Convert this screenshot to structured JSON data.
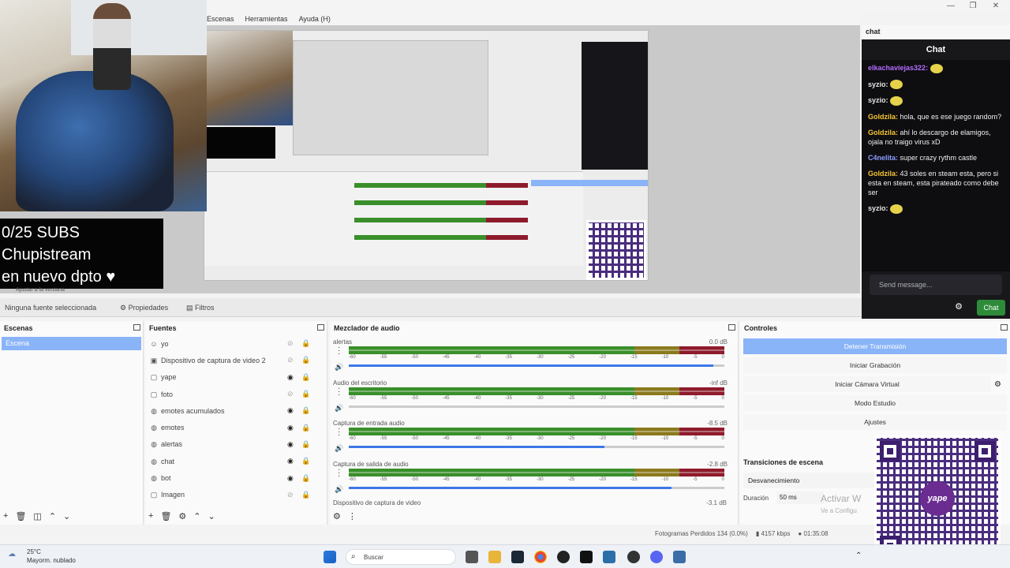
{
  "menu": [
    "Escenas",
    "Herramientas",
    "Ayuda (H)"
  ],
  "window_controls": [
    "—",
    "❐",
    "✕"
  ],
  "overlay": {
    "subs_lines": [
      "0/25 SUBS",
      "Chupistream",
      "en nuevo dpto ♥"
    ]
  },
  "preview_bottom_label": "Ajustar a la ventana",
  "status_bar": {
    "no_source": "Ninguna fuente seleccionada",
    "properties": "Propiedades",
    "filters": "Filtros"
  },
  "scenes": {
    "title": "Escenas",
    "items": [
      "Escena"
    ]
  },
  "sources": {
    "title": "Fuentes",
    "items": [
      {
        "label": "yo",
        "icon": "person-icon",
        "visible": false,
        "locked": false
      },
      {
        "label": "Dispositivo de captura de video 2",
        "icon": "camera-icon",
        "visible": false,
        "locked": false
      },
      {
        "label": "yape",
        "icon": "image-icon",
        "visible": true,
        "locked": false
      },
      {
        "label": "foto",
        "icon": "image-icon",
        "visible": false,
        "locked": false
      },
      {
        "label": "emotes acumulados",
        "icon": "globe-icon",
        "visible": true,
        "locked": false
      },
      {
        "label": "emotes",
        "icon": "globe-icon",
        "visible": true,
        "locked": false
      },
      {
        "label": "alertas",
        "icon": "globe-icon",
        "visible": true,
        "locked": false
      },
      {
        "label": "chat",
        "icon": "globe-icon",
        "visible": true,
        "locked": false
      },
      {
        "label": "bot",
        "icon": "globe-icon",
        "visible": true,
        "locked": true
      },
      {
        "label": "Imagen",
        "icon": "image-icon",
        "visible": false,
        "locked": true
      }
    ]
  },
  "mixer": {
    "title": "Mezclador de audio",
    "ticks": [
      "-60",
      "-55",
      "-50",
      "-45",
      "-40",
      "-35",
      "-30",
      "-25",
      "-20",
      "-15",
      "-10",
      "-5",
      "0"
    ],
    "channels": [
      {
        "name": "alertas",
        "db": "0.0 dB",
        "volume": 0.97
      },
      {
        "name": "Audio del escritorio",
        "db": "-inf dB",
        "volume": 0.0
      },
      {
        "name": "Captura de entrada audio",
        "db": "-8.5 dB",
        "volume": 0.68
      },
      {
        "name": "Captura de salida de audio",
        "db": "-2.8 dB",
        "volume": 0.86
      }
    ],
    "last_channel": {
      "name": "Dispositivo de captura de video",
      "db": "-3.1 dB"
    }
  },
  "controls": {
    "title": "Controles",
    "buttons": [
      "Detener Transmisión",
      "Iniciar Grabación",
      "Iniciar Cámara Virtual",
      "Modo Estudio",
      "Ajustes"
    ]
  },
  "transitions": {
    "title": "Transiciones de escena",
    "selected": "Desvanecimiento",
    "duration_label": "Duración",
    "duration_value": "50 ms"
  },
  "stats": {
    "dropped": "Fotogramas Perdidos 134 (0.0%)",
    "bitrate": "4157 kbps",
    "time": "01:35:08"
  },
  "activate_windows": "Activar W",
  "activate_windows_sub": "Ve a Configu",
  "chat": {
    "dock_title": "chat",
    "header": "Chat",
    "messages": [
      {
        "user": "elkachaviejas322:",
        "text": "",
        "color": "#b46cff"
      },
      {
        "user": "syzio:",
        "text": "",
        "color": "#e5e5e5"
      },
      {
        "user": "syzio:",
        "text": "",
        "color": "#e5e5e5"
      },
      {
        "user": "Goldzila:",
        "text": "hola, que es ese juego random?",
        "color": "#f7c531"
      },
      {
        "user": "Goldzila:",
        "text": "ahí lo descargo de elamigos, ojala no traigo virus xD",
        "color": "#f7c531"
      },
      {
        "user": "C4nelita:",
        "text": "super crazy rythm castle",
        "color": "#8b9eff"
      },
      {
        "user": "Goldzila:",
        "text": "43 soles en steam esta, pero si esta en steam, esta pirateado como debe ser",
        "color": "#f7c531"
      },
      {
        "user": "syzio:",
        "text": "",
        "color": "#e5e5e5"
      }
    ],
    "placeholder": "Send message...",
    "send_label": "Chat"
  },
  "qr_label": "yape",
  "weather": {
    "temp": "25°C",
    "desc": "Mayorm. nublado"
  },
  "taskbar": {
    "search": "Buscar"
  }
}
